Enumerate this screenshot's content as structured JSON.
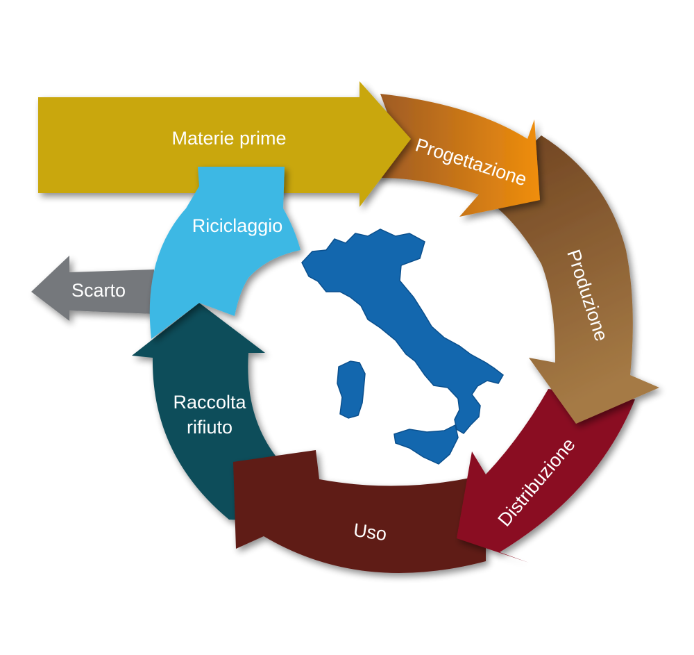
{
  "diagram": {
    "stages": {
      "raw_materials": "Materie prime",
      "design": "Progettazione",
      "production": "Produzione",
      "distribution": "Distribuzione",
      "use": "Uso",
      "waste_collection_line1": "Raccolta",
      "waste_collection_line2": "rifiuto",
      "recycling": "Riciclaggio",
      "discard": "Scarto"
    },
    "colors": {
      "raw_materials": "#C9A70A",
      "design_start": "#9C5A25",
      "design_end": "#F08E0C",
      "production_start": "#6E4220",
      "production_end": "#A57A45",
      "distribution": "#8A1020",
      "use": "#5E1B19",
      "waste_collection": "#0E4D5A",
      "recycling": "#3DB8E4",
      "discard": "#75787B",
      "map": "#1367AE"
    }
  }
}
